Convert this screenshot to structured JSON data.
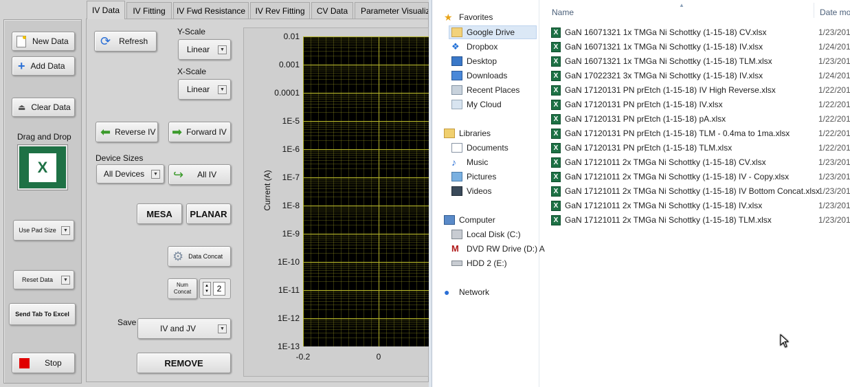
{
  "tabs": [
    "IV Data",
    "IV Fitting",
    "IV Fwd Resistance",
    "IV Rev Fitting",
    "CV Data",
    "Parameter Visualiz"
  ],
  "left_panel": {
    "new_data": "New Data",
    "add_data": "Add Data",
    "clear_data": "Clear Data",
    "drag_drop": "Drag and Drop",
    "use_pad_size": "Use Pad Size",
    "reset_data": "Reset Data",
    "send_tab": "Send Tab To Excel",
    "stop": "Stop"
  },
  "controls": {
    "refresh": "Refresh",
    "y_scale_label": "Y-Scale",
    "y_scale_value": "Linear",
    "x_scale_label": "X-Scale",
    "x_scale_value": "Linear",
    "reverse_iv": "Reverse IV",
    "forward_iv": "Forward IV",
    "device_sizes_label": "Device Sizes",
    "device_sizes_value": "All Devices",
    "all_iv": "All IV",
    "mesa": "MESA",
    "planar": "PLANAR",
    "data_concat": "Data Concat",
    "num_concat_label_1": "Num",
    "num_concat_label_2": "Concat",
    "num_concat_value": "2",
    "save_label": "Save",
    "save_value": "IV and JV",
    "remove": "REMOVE"
  },
  "chart_data": {
    "type": "line",
    "ylabel": "Current (A)",
    "y_scale": "log",
    "y_ticks": [
      "0.01",
      "0.001",
      "0.0001",
      "1E-5",
      "1E-6",
      "1E-7",
      "1E-8",
      "1E-9",
      "1E-10",
      "1E-11",
      "1E-12",
      "1E-13"
    ],
    "x_ticks": [
      "-0.2",
      "0"
    ],
    "grid": true,
    "series": []
  },
  "explorer": {
    "col_name": "Name",
    "col_date": "Date mo",
    "favorites_header": "Favorites",
    "favorites": [
      "Google Drive",
      "Dropbox",
      "Desktop",
      "Downloads",
      "Recent Places",
      "My Cloud"
    ],
    "libraries_header": "Libraries",
    "libraries": [
      "Documents",
      "Music",
      "Pictures",
      "Videos"
    ],
    "computer_header": "Computer",
    "drives": [
      "Local Disk (C:)",
      "DVD RW Drive (D:) A",
      "HDD 2 (E:)"
    ],
    "network": "Network",
    "files": [
      {
        "name": "GaN 16071321 1x TMGa Ni Schottky (1-15-18) CV.xlsx",
        "date": "1/23/201"
      },
      {
        "name": "GaN 16071321 1x TMGa Ni Schottky (1-15-18) IV.xlsx",
        "date": "1/24/201"
      },
      {
        "name": "GaN 16071321 1x TMGa Ni Schottky (1-15-18) TLM.xlsx",
        "date": "1/23/201"
      },
      {
        "name": "GaN 17022321 3x TMGa Ni Schottky (1-15-18) IV.xlsx",
        "date": "1/24/201"
      },
      {
        "name": "GaN 17120131 PN prEtch (1-15-18) IV High Reverse.xlsx",
        "date": "1/22/201"
      },
      {
        "name": "GaN 17120131 PN prEtch (1-15-18) IV.xlsx",
        "date": "1/22/201"
      },
      {
        "name": "GaN 17120131 PN prEtch (1-15-18) pA.xlsx",
        "date": "1/22/201"
      },
      {
        "name": "GaN 17120131 PN prEtch (1-15-18) TLM - 0.4ma to 1ma.xlsx",
        "date": "1/22/201"
      },
      {
        "name": "GaN 17120131 PN prEtch (1-15-18) TLM.xlsx",
        "date": "1/22/201"
      },
      {
        "name": "GaN 17121011 2x TMGa Ni Schottky (1-15-18) CV.xlsx",
        "date": "1/23/201"
      },
      {
        "name": "GaN 17121011 2x TMGa Ni Schottky (1-15-18) IV - Copy.xlsx",
        "date": "1/23/201"
      },
      {
        "name": "GaN 17121011 2x TMGa Ni Schottky (1-15-18) IV Bottom Concat.xlsx",
        "date": "1/23/201"
      },
      {
        "name": "GaN 17121011 2x TMGa Ni Schottky (1-15-18) IV.xlsx",
        "date": "1/23/201"
      },
      {
        "name": "GaN 17121011 2x TMGa Ni Schottky (1-15-18) TLM.xlsx",
        "date": "1/23/201"
      }
    ]
  },
  "colors": {
    "plot_bg": "#000000",
    "grid": "#b5b52a",
    "stop_red": "#e00000",
    "excel_green": "#1e7145"
  }
}
